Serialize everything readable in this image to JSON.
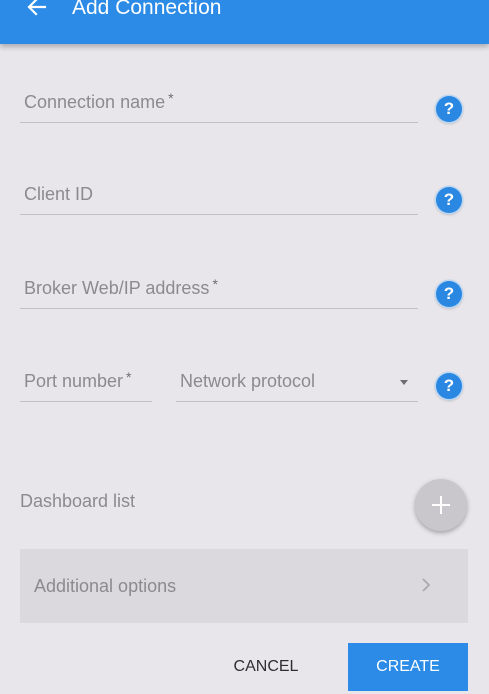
{
  "app_bar": {
    "title": "Add Connection",
    "back_icon": "arrow-left-icon",
    "color": "#2b8be6"
  },
  "form": {
    "connection_name": {
      "label": "Connection name",
      "required_mark": "*"
    },
    "client_id": {
      "label": "Client ID"
    },
    "broker_address": {
      "label": "Broker Web/IP address",
      "required_mark": "*"
    },
    "port_number": {
      "label": "Port number",
      "required_mark": "*"
    },
    "network_protocol": {
      "label": "Network protocol"
    },
    "help_icon_glyph": "?"
  },
  "dashboard": {
    "label": "Dashboard list",
    "add_icon": "plus-icon"
  },
  "additional_options": {
    "label": "Additional options",
    "icon": "chevron-right-icon"
  },
  "actions": {
    "cancel_label": "CANCEL",
    "create_label": "CREATE"
  }
}
